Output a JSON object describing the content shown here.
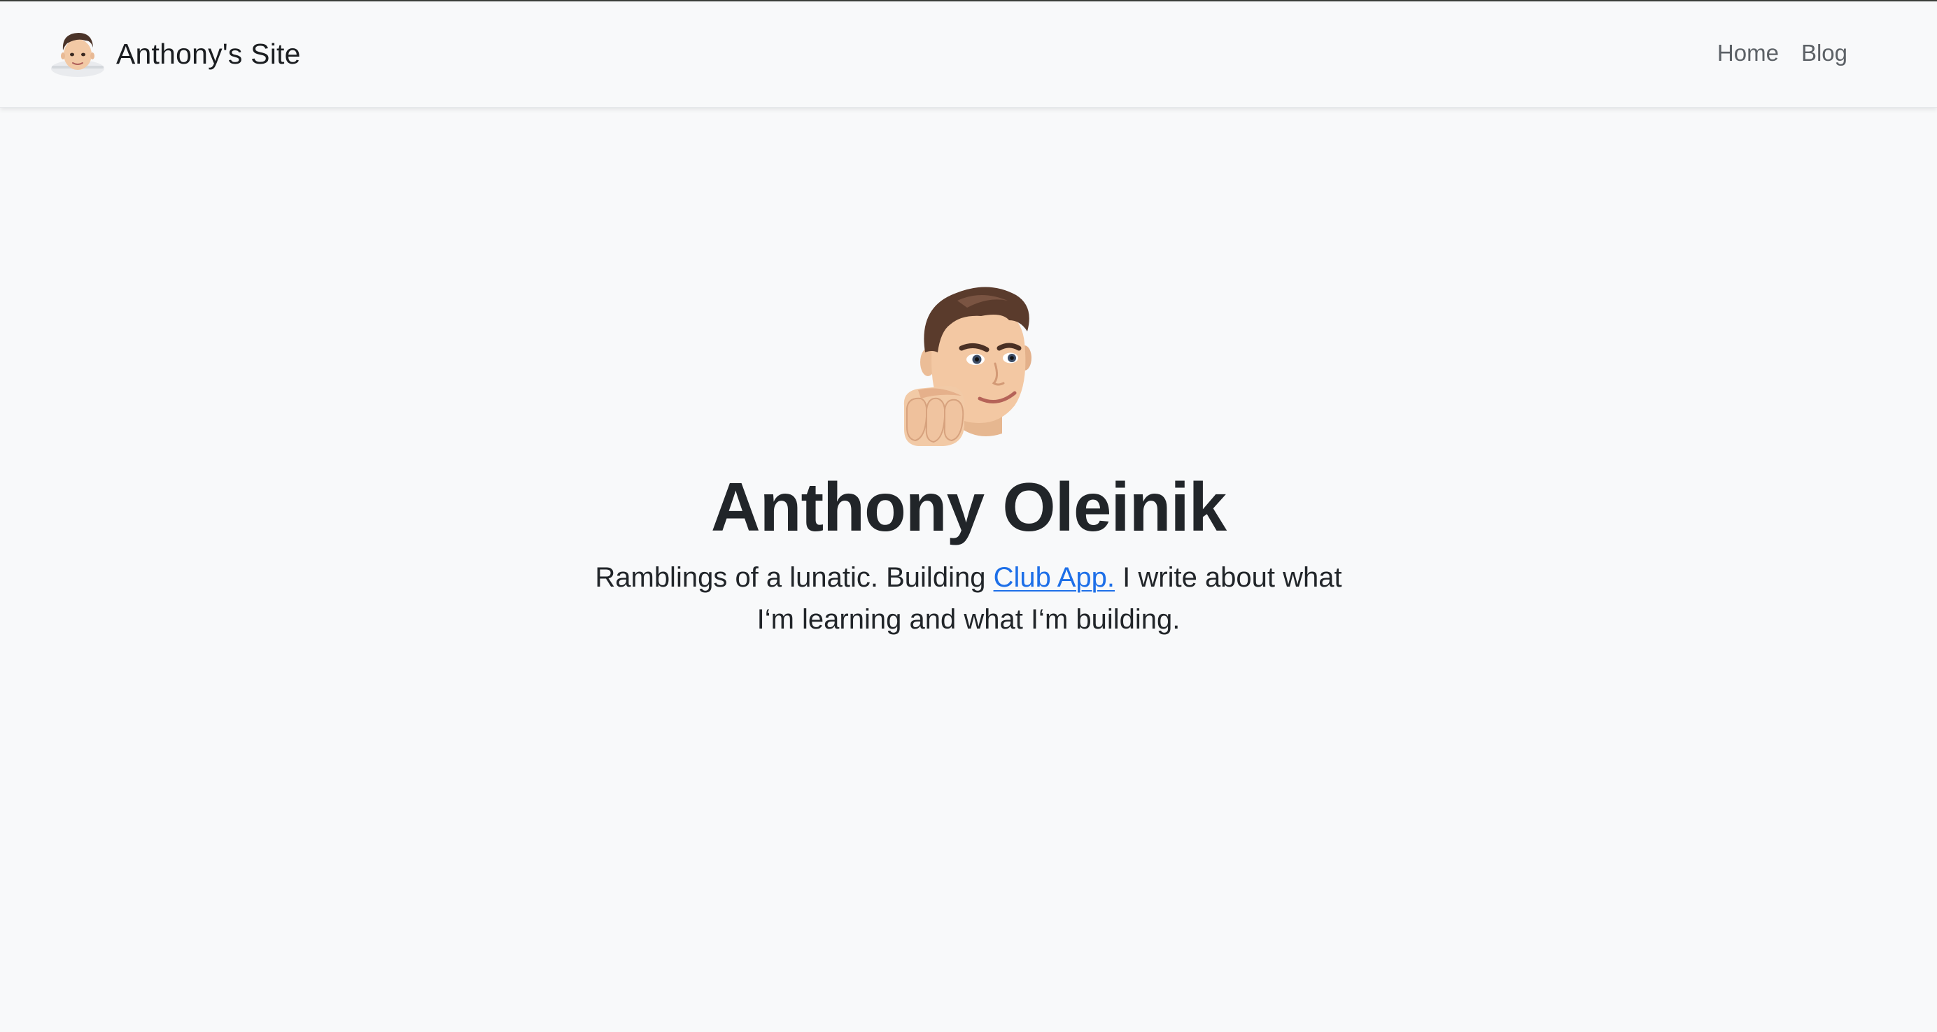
{
  "navbar": {
    "brand_name": "Anthony's Site",
    "links": [
      {
        "label": "Home"
      },
      {
        "label": "Blog"
      }
    ]
  },
  "hero": {
    "title": "Anthony Oleinik",
    "subtitle_before": "Ramblings of a lunatic. Building ",
    "subtitle_link": "Club App.",
    "subtitle_after": " I write about what I‘m learning and what I‘m building."
  },
  "colors": {
    "background": "#f8f9fa",
    "text": "#212529",
    "nav_link": "#5c6166",
    "link_accent": "#1d6fe8"
  },
  "icons": {
    "brand_avatar": "memoji-avatar-icon",
    "hero_avatar": "memoji-fist-bump-icon"
  }
}
